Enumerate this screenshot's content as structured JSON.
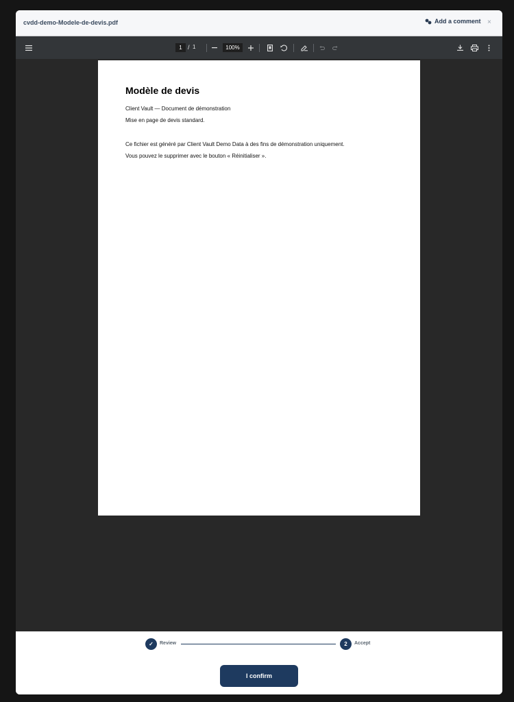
{
  "header": {
    "file_name": "cvdd-demo-Modele-de-devis.pdf",
    "comment_label": "Add a comment",
    "close_label": "×"
  },
  "toolbar": {
    "current_page": "1",
    "page_separator": "/",
    "total_pages": "1",
    "zoom": "100%",
    "icons": [
      "menu-icon",
      "zoom-out-icon",
      "zoom-in-icon",
      "fit-page-icon",
      "rotate-icon",
      "annotate-icon",
      "undo-icon",
      "redo-icon",
      "download-icon",
      "print-icon",
      "more-icon"
    ]
  },
  "document": {
    "title": "Modèle de devis",
    "lines": [
      "Client Vault — Document de démonstration",
      "Mise en page de devis standard.",
      "Ce fichier est généré par Client Vault Demo Data à des fins de démonstration uniquement.",
      "Vous pouvez le supprimer avec le bouton « Réinitialiser »."
    ]
  },
  "stepper": {
    "steps": [
      {
        "label": "Review",
        "status": "done",
        "marker": "✓"
      },
      {
        "label": "Accept",
        "status": "current",
        "marker": "2"
      }
    ]
  },
  "footer": {
    "confirm_label": "I confirm"
  },
  "colors": {
    "accent": "#1e3a5f",
    "toolbar": "#333639",
    "viewer_bg": "#282828"
  }
}
